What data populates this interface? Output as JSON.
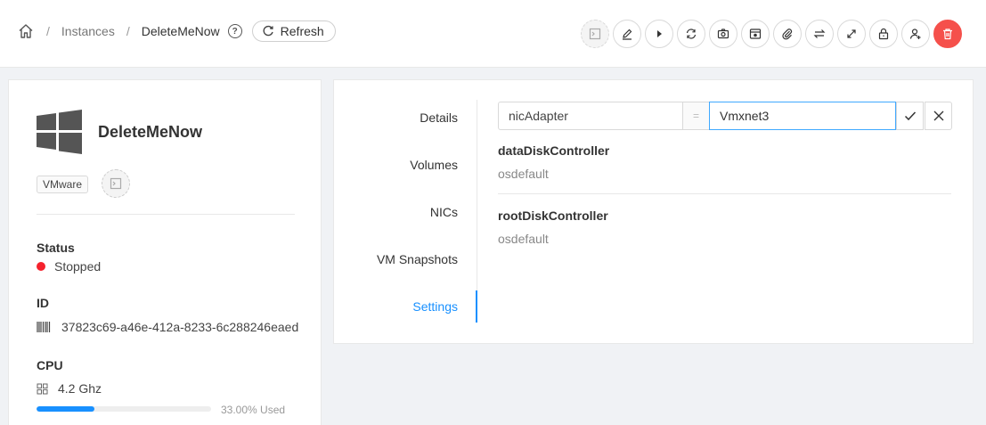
{
  "breadcrumb": {
    "home_icon": "home-icon",
    "separator": "/",
    "instances": "Instances",
    "current": "DeleteMeNow",
    "help_icon": "question-circle-icon",
    "refresh_label": "Refresh"
  },
  "actions": [
    {
      "name": "console-button",
      "icon": "console-icon"
    },
    {
      "name": "edit-button",
      "icon": "edit-icon"
    },
    {
      "name": "start-button",
      "icon": "play-icon"
    },
    {
      "name": "reinstall-button",
      "icon": "sync-icon"
    },
    {
      "name": "snapshot-button",
      "icon": "camera-icon"
    },
    {
      "name": "backup-button",
      "icon": "storage-icon"
    },
    {
      "name": "attach-iso-button",
      "icon": "paperclip-icon"
    },
    {
      "name": "migrate-button",
      "icon": "swap-icon"
    },
    {
      "name": "scale-button",
      "icon": "arrows-alt-icon"
    },
    {
      "name": "reset-password-button",
      "icon": "lock-icon"
    },
    {
      "name": "assign-vm-button",
      "icon": "user-add-icon"
    },
    {
      "name": "destroy-button",
      "icon": "delete-icon"
    }
  ],
  "vm": {
    "name": "DeleteMeNow",
    "os_icon": "windows-icon",
    "hypervisor": "VMware",
    "status_label": "Status",
    "status": "Stopped",
    "status_color": "#f5222d",
    "id_label": "ID",
    "id": "37823c69-a46e-412a-8233-6c288246eaed",
    "cpu_label": "CPU",
    "cpu": "4.2 Ghz",
    "cpu_used_fraction": 0.33,
    "cpu_used_text": "33.00% Used"
  },
  "tabs": [
    {
      "label": "Details",
      "active": false
    },
    {
      "label": "Volumes",
      "active": false
    },
    {
      "label": "NICs",
      "active": false
    },
    {
      "label": "VM Snapshots",
      "active": false
    },
    {
      "label": "Settings",
      "active": true
    }
  ],
  "settings": {
    "key_value": "nicAdapter",
    "equals": "=",
    "value_value": "Vmxnet3",
    "items": [
      {
        "name": "dataDiskController",
        "value": "osdefault"
      },
      {
        "name": "rootDiskController",
        "value": "osdefault"
      }
    ]
  },
  "colors": {
    "accent": "#1890ff",
    "danger": "#f5504b"
  }
}
